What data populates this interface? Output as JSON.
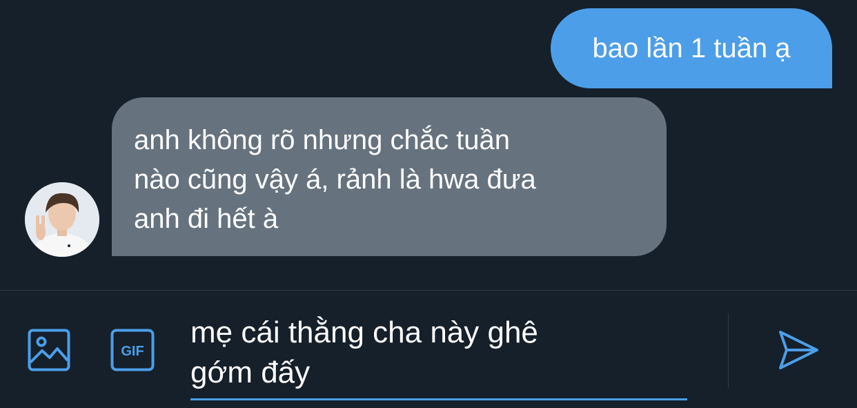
{
  "conversation": {
    "sent_message": "bao lần 1 tuần ạ",
    "received_message": "anh không rõ nhưng chắc tuần\nnào cũng vậy á, rảnh là hwa đưa\nanh đi hết à"
  },
  "composer": {
    "draft_text": "mẹ cái thằng cha này ghê\ngớm đấy",
    "gif_label": "GIF"
  },
  "icons": {
    "image": "image-icon",
    "gif": "gif-icon",
    "send": "send-icon"
  },
  "colors": {
    "background": "#15202b",
    "accent": "#4c9ee8",
    "received_bubble": "#66737f"
  }
}
